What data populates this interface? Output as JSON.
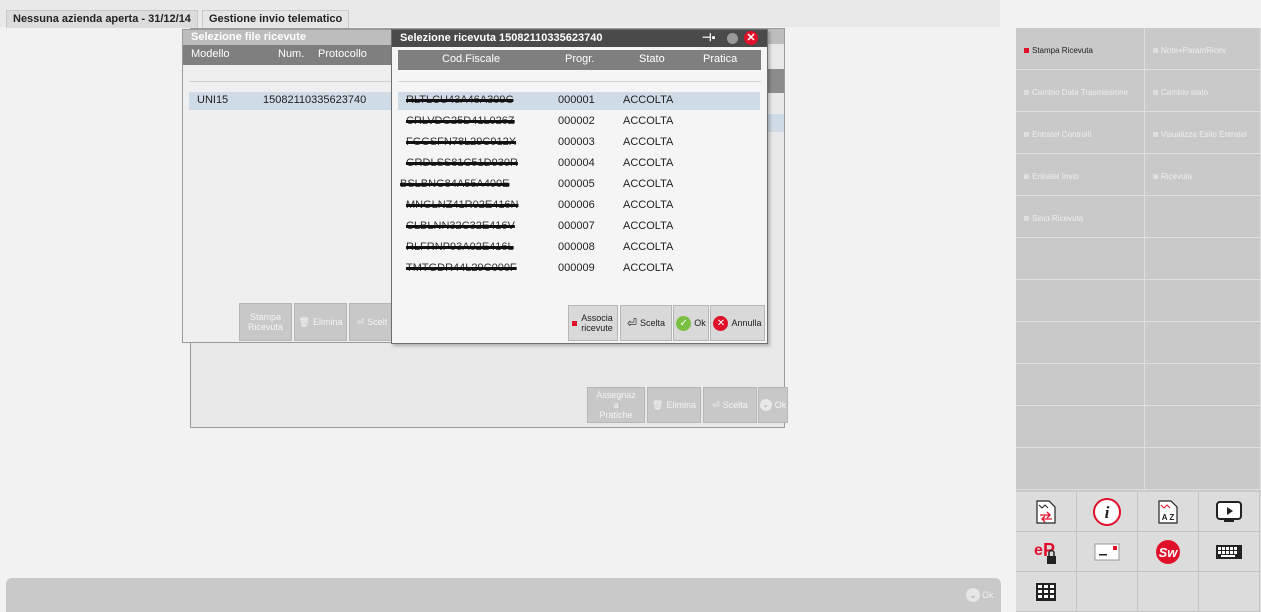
{
  "tabs": [
    {
      "label": "Nessuna azienda aperta - 31/12/14"
    },
    {
      "label": "Gestione invio telematico"
    }
  ],
  "file_window": {
    "title": "Selezione file ricevute",
    "columns": [
      "Modello",
      "Num.",
      "Protocollo"
    ],
    "rows": [
      {
        "modello": "UNI15",
        "protocollo": "15082110335623740"
      }
    ],
    "buttons": {
      "stampa": "Stampa Ricevuta",
      "elimina": "Elimina",
      "scelta": "Scelt"
    }
  },
  "receipt_window": {
    "title": "Selezione ricevuta 15082110335623740",
    "columns": [
      "Cod.Fiscale",
      "Progr.",
      "Stato",
      "Pratica"
    ],
    "rows": [
      {
        "cf": "RLTLCU43A46A309C",
        "progr": "000001",
        "stato": "ACCOLTA"
      },
      {
        "cf": "CRLVDG25D41L026Z",
        "progr": "000002",
        "stato": "ACCOLTA"
      },
      {
        "cf": "FGGSFN78L29C912X",
        "progr": "000003",
        "stato": "ACCOLTA"
      },
      {
        "cf": "GRDLSS81C51D930R",
        "progr": "000004",
        "stato": "ACCOLTA"
      },
      {
        "cf": "BSLBNG84A55A400E",
        "progr": "000005",
        "stato": "ACCOLTA"
      },
      {
        "cf": "MNGLNZ41R02E416N",
        "progr": "000006",
        "stato": "ACCOLTA"
      },
      {
        "cf": "CLBLNN32C32E416V",
        "progr": "000007",
        "stato": "ACCOLTA"
      },
      {
        "cf": "RLFRNP93A02E416L",
        "progr": "000008",
        "stato": "ACCOLTA"
      },
      {
        "cf": "TMTGDR44L29C000F",
        "progr": "000009",
        "stato": "ACCOLTA"
      }
    ],
    "buttons": {
      "associa": "Associa ricevute",
      "scelta": "Scelta",
      "ok": "Ok",
      "annulla": "Annulla"
    }
  },
  "bg_window": {
    "buttons": {
      "assegnaz": "Assegnaz a Pratiche",
      "elimina": "Elimina",
      "scelta": "Scelta",
      "ok": "Ok"
    }
  },
  "sidebar": {
    "buttons": [
      {
        "label": "Stampa Ricevuta",
        "active": true
      },
      {
        "label": "Note+ParamRicev",
        "active": false
      },
      {
        "label": "Cambio Data Trasmissione",
        "active": false
      },
      {
        "label": "Cambio stato",
        "active": false
      },
      {
        "label": "Entratel Controlli",
        "active": false
      },
      {
        "label": "Visualizza Esito Entratel",
        "active": false
      },
      {
        "label": "Entratel Invio",
        "active": false
      },
      {
        "label": "Ricevuta",
        "active": false
      },
      {
        "label": "Sincr.Ricevuta",
        "active": false
      }
    ],
    "icons": [
      "transfer-doc-icon",
      "info-icon",
      "sort-az-icon",
      "video-icon",
      "ep-lock-icon",
      "card-icon",
      "sw-logo-icon",
      "keyboard-icon",
      "grid-icon"
    ]
  },
  "status": {
    "ok_label": "Ok"
  },
  "colors": {
    "accent_red": "#e0102a",
    "header_grey": "#7f7f7f",
    "title_dark": "#4a4a4a",
    "ok_green": "#7ac143"
  }
}
